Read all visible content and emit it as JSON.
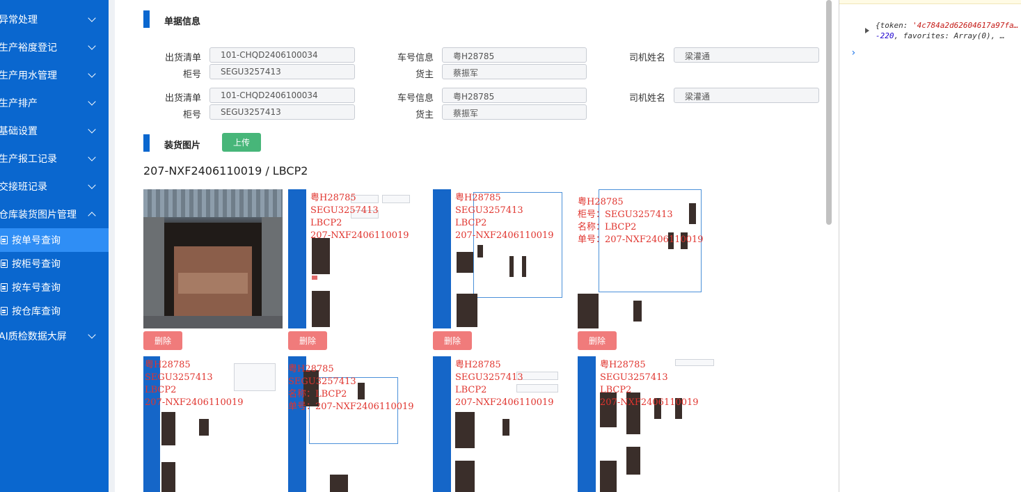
{
  "sidebar": {
    "menus": [
      {
        "label": "异常处理"
      },
      {
        "label": "生产裕度登记"
      },
      {
        "label": "生产用水管理"
      },
      {
        "label": "生产排产"
      },
      {
        "label": "基础设置"
      },
      {
        "label": "生产报工记录"
      },
      {
        "label": "交接班记录"
      },
      {
        "label": "仓库装货图片管理"
      }
    ],
    "sub_items": [
      {
        "label": "按单号查询",
        "active": true
      },
      {
        "label": "按柜号查询"
      },
      {
        "label": "按车号查询"
      },
      {
        "label": "按仓库查询"
      }
    ],
    "bottom_menu": {
      "label": "AI质检数据大屏"
    }
  },
  "bill": {
    "section_title": "单据信息",
    "groups": [
      {
        "shipment_label": "出货清单",
        "shipment_value": "101-CHQD2406100034",
        "vehicle_label": "车号信息",
        "vehicle_value": "粤H28785",
        "driver_label": "司机姓名",
        "driver_value": "梁灌通",
        "cabinet_label": "柜号",
        "cabinet_value": "SEGU3257413",
        "owner_label": "货主",
        "owner_value": "蔡振军"
      },
      {
        "shipment_label": "出货清单",
        "shipment_value": "101-CHQD2406100034",
        "vehicle_label": "车号信息",
        "vehicle_value": "粤H28785",
        "driver_label": "司机姓名",
        "driver_value": "梁灌通",
        "cabinet_label": "柜号",
        "cabinet_value": "SEGU3257413",
        "owner_label": "货主",
        "owner_value": "蔡振军"
      }
    ]
  },
  "photos": {
    "section_title": "装货图片",
    "upload_label": "上传",
    "order_title": "207-NXF2406110019 / LBCP2",
    "delete_label": "删除",
    "overlay": {
      "vehicle": "粤H28785",
      "cabinet": "SEGU3257413",
      "product": "LBCP2",
      "order": "207-NXF2406110019",
      "prefixed_cabinet": "柜号：SEGU3257413",
      "prefixed_product": "名称：LBCP2",
      "prefixed_order": "单号：207-NXF2406110019"
    }
  },
  "console": {
    "line1_prefix": "{token: ",
    "token": "'4c784a2d62604617a97fa…",
    "line2_num": "-220",
    "line2_rest": ", favorites: Array(0),  …"
  },
  "colors": {
    "sidebar": "#0a67cf",
    "active_sub": "#2f8ef5",
    "upload": "#47b679",
    "delete": "#f07b7b"
  }
}
